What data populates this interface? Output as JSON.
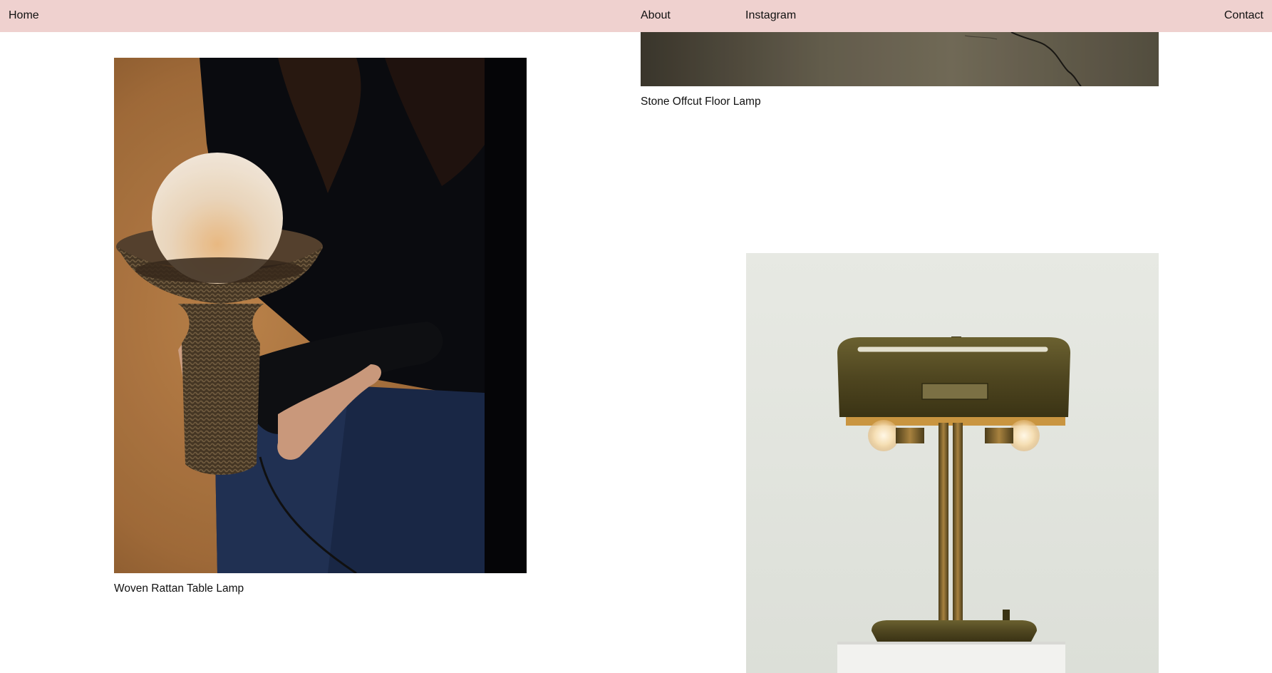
{
  "nav": {
    "home": "Home",
    "about": "About",
    "instagram": "Instagram",
    "contact": "Contact"
  },
  "products": [
    {
      "caption": "Stone Offcut Floor Lamp"
    },
    {
      "caption": "Woven Rattan Table Lamp"
    },
    {
      "caption": ""
    }
  ],
  "colors": {
    "nav_background": "#efd1cf",
    "page_background": "#ffffff"
  }
}
